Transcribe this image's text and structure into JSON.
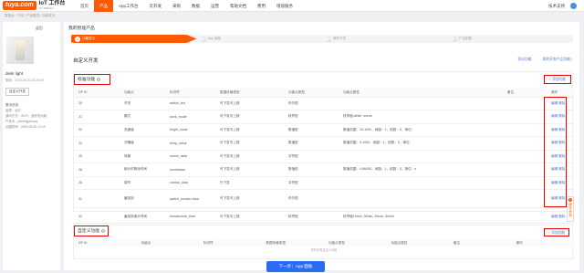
{
  "header": {
    "logo_mark": "tuya.com",
    "logo_title": "IoT 工作台",
    "logo_sub": "IoT Platform",
    "nav": [
      "首页",
      "产品",
      "App工作台",
      "云开发",
      "采购",
      "数据",
      "运营",
      "帮助文档",
      "费用",
      "增值服务"
    ],
    "active_nav": 1,
    "support": "技术支持"
  },
  "breadcrumb": "智能台 / 产品 / 产品概况 / 功能定义",
  "product": {
    "back": "返回",
    "name": "desk light",
    "updated": "更新：2020-05-20 20:25:05",
    "button": "自定义开发",
    "info_title": "基本信息",
    "info": [
      "品类：台灯",
      "通讯方式：Wi-Fi、蓝牙低功耗",
      "产品ID：pkhbdgjzhowq",
      "创建时间：2020-05-20 21:19"
    ]
  },
  "main": {
    "title": "我的智能产品",
    "steps": [
      {
        "num": "1",
        "label": "功能定义"
      },
      {
        "num": "2",
        "label": "App 面板"
      },
      {
        "num": "3",
        "label": "硬件开发"
      },
      {
        "num": "4",
        "label": "产品配置"
      }
    ],
    "section_title": "自定义开发",
    "links": [
      "导出功能",
      "如何开发产品功能?"
    ]
  },
  "standard": {
    "title": "标准功能",
    "add_label": "+ 添加功能",
    "columns": [
      "DP ID",
      "功能点",
      "标识符",
      "数据传输类型",
      "功能点类型",
      "功能点属性",
      "备注",
      "操作"
    ],
    "rows": [
      {
        "id": "20",
        "name": "开关",
        "code": "switch_led",
        "trans": "可下发可上报",
        "type": "布尔型",
        "attr": "",
        "note": "",
        "edit": "编辑",
        "del": "删除"
      },
      {
        "id": "21",
        "name": "模式",
        "code": "work_mode",
        "trans": "可下发可上报",
        "type": "枚举型",
        "attr": "枚举值:white, scene",
        "note": "",
        "edit": "编辑",
        "del": "删除"
      },
      {
        "id": "22",
        "name": "亮度值",
        "code": "bright_value",
        "trans": "可下发可上报",
        "type": "数值型",
        "attr": "数值范围：10-1000，间距：1，倍数：0，单位：",
        "note": "",
        "edit": "编辑",
        "del": "删除"
      },
      {
        "id": "23",
        "name": "冷暖值",
        "code": "temp_value",
        "trans": "可下发可上报",
        "type": "数值型",
        "attr": "数值范围：0-1000，间距：1，倍数：0，单位：",
        "note": "",
        "edit": "编辑",
        "del": "删除"
      },
      {
        "id": "25",
        "name": "场景",
        "code": "scene_data",
        "trans": "可下发可上报",
        "type": "字符型",
        "attr": "",
        "note": "",
        "edit": "编辑",
        "del": "删除"
      },
      {
        "id": "26",
        "name": "倒计时剩余时间",
        "code": "countdown",
        "trans": "可下发可上报",
        "type": "数值型",
        "attr": "数值范围：0-86400，间距：1，倍数：0，单位：s",
        "note": "",
        "edit": "编辑",
        "del": "删除"
      },
      {
        "id": "28",
        "name": "调节",
        "code": "control_data",
        "trans": "只下发",
        "type": "字符型",
        "attr": "",
        "note": "",
        "edit": "编辑",
        "del": "删除"
      },
      {
        "id": "31",
        "name": "番茄钟",
        "code": "switch_tomato clock",
        "trans": "可下发可上报",
        "type": "布尔型",
        "attr": "",
        "note": "",
        "edit": "编辑",
        "del": "删除"
      },
      {
        "id": "32",
        "name": "番茄钟倒计时间",
        "code": "tomatoclock_time",
        "trans": "可下发可上报",
        "type": "枚举型",
        "attr": "枚举值15min, 30min, 45min, 60min",
        "note": "",
        "edit": "编辑",
        "del": "删除"
      }
    ]
  },
  "custom": {
    "title": "自定义功能",
    "add_label": "+ 添加功能",
    "columns": [
      "DP ID",
      "功能点",
      "标识符",
      "数据传输类型",
      "功能点类型",
      "功能点属性",
      "备注",
      "操作"
    ],
    "empty": "暂时没有自定义功能"
  },
  "footer": {
    "next": "下一步：App 面板",
    "float": "服务咨询"
  }
}
